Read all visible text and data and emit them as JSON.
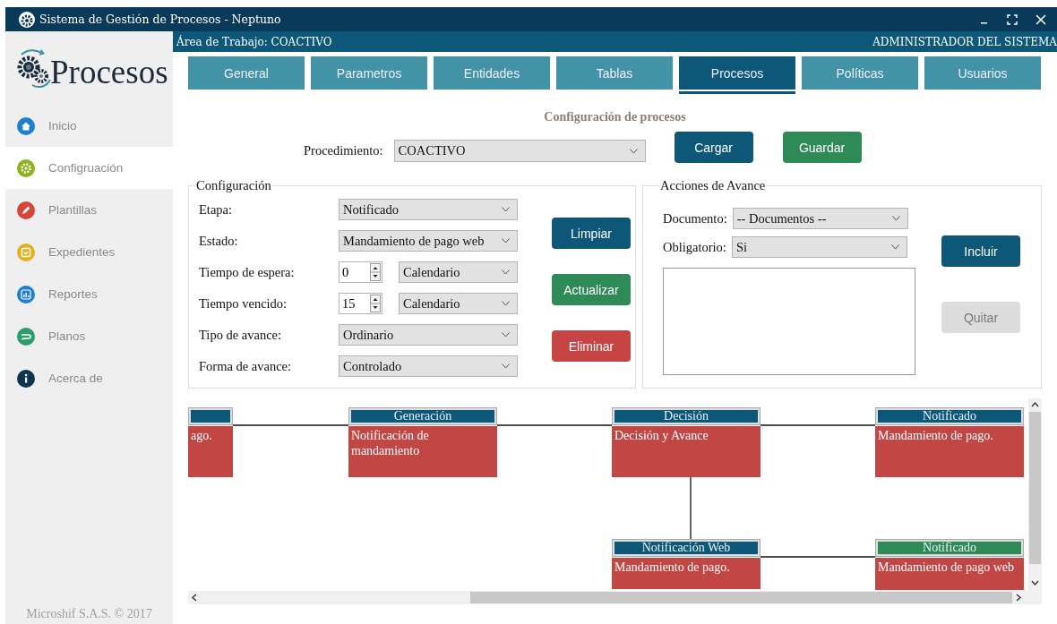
{
  "window": {
    "title": "Sistema de Gestión de Procesos - Neptuno"
  },
  "header": {
    "workspace": "Área de Trabajo: COACTIVO",
    "user": "ADMINISTRADOR DEL SISTEMA"
  },
  "logo": {
    "text": "Procesos"
  },
  "sidebar": {
    "items": [
      {
        "label": "Inicio",
        "selected": false
      },
      {
        "label": "Configruación",
        "selected": true
      },
      {
        "label": "Plantillas",
        "selected": false
      },
      {
        "label": "Expedientes",
        "selected": false
      },
      {
        "label": "Reportes",
        "selected": false
      },
      {
        "label": "Planos",
        "selected": false
      },
      {
        "label": "Acerca de",
        "selected": false
      }
    ],
    "footer": "Microshif S.A.S. © 2017"
  },
  "tabs": [
    {
      "label": "General",
      "selected": false
    },
    {
      "label": "Parametros",
      "selected": false
    },
    {
      "label": "Entidades",
      "selected": false
    },
    {
      "label": "Tablas",
      "selected": false
    },
    {
      "label": "Procesos",
      "selected": true
    },
    {
      "label": "Políticas",
      "selected": false
    },
    {
      "label": "Usuarios",
      "selected": false
    }
  ],
  "page_title": "Configuración de procesos",
  "procedure": {
    "label": "Procedimiento:",
    "value": "COACTIVO"
  },
  "top_buttons": [
    {
      "label": "Cargar",
      "kind": "primary"
    },
    {
      "label": "Guardar",
      "kind": "success"
    }
  ],
  "configuration": {
    "title": "Configuración",
    "fields": [
      {
        "label": "Etapa:",
        "kind": "select",
        "value": "Notificado"
      },
      {
        "label": "Estado:",
        "kind": "select",
        "value": "Mandamiento de pago web"
      },
      {
        "label": "Tiempo de espera:",
        "kind": "spinner",
        "value": "0",
        "unit": "Calendario"
      },
      {
        "label": "Tiempo vencido:",
        "kind": "spinner",
        "value": "15",
        "unit": "Calendario"
      },
      {
        "label": "Tipo de avance:",
        "kind": "select",
        "value": "Ordinario"
      },
      {
        "label": "Forma de avance:",
        "kind": "select",
        "value": "Controlado"
      }
    ],
    "buttons": [
      {
        "label": "Limpiar",
        "kind": "primary"
      },
      {
        "label": "Actualizar",
        "kind": "success"
      },
      {
        "label": "Eliminar",
        "kind": "danger"
      }
    ]
  },
  "actions": {
    "title": "Acciones de Avance",
    "fields": [
      {
        "label": "Documento:",
        "value": "-- Documentos --"
      },
      {
        "label": "Obligatorio:",
        "value": "Si"
      }
    ],
    "buttons": [
      {
        "label": "Incluir",
        "kind": "primary",
        "disabled": false
      },
      {
        "label": "Quitar",
        "kind": "primary",
        "disabled": true
      }
    ]
  },
  "diagram": {
    "nodes": [
      {
        "description": "ago.",
        "selected": false
      },
      {
        "title": "Generación",
        "description": "Notificación de mandamiento",
        "selected": false
      },
      {
        "title": "Decisión",
        "description": "Decisión y Avance",
        "selected": false
      },
      {
        "title": "Notificado",
        "description": "Mandamiento de pago.",
        "selected": false
      },
      {
        "title": "Notificación Web",
        "description": "Mandamiento de pago.",
        "selected": false
      },
      {
        "title": "Notificado",
        "description": "Mandamiento de pago web",
        "selected": true
      }
    ]
  }
}
